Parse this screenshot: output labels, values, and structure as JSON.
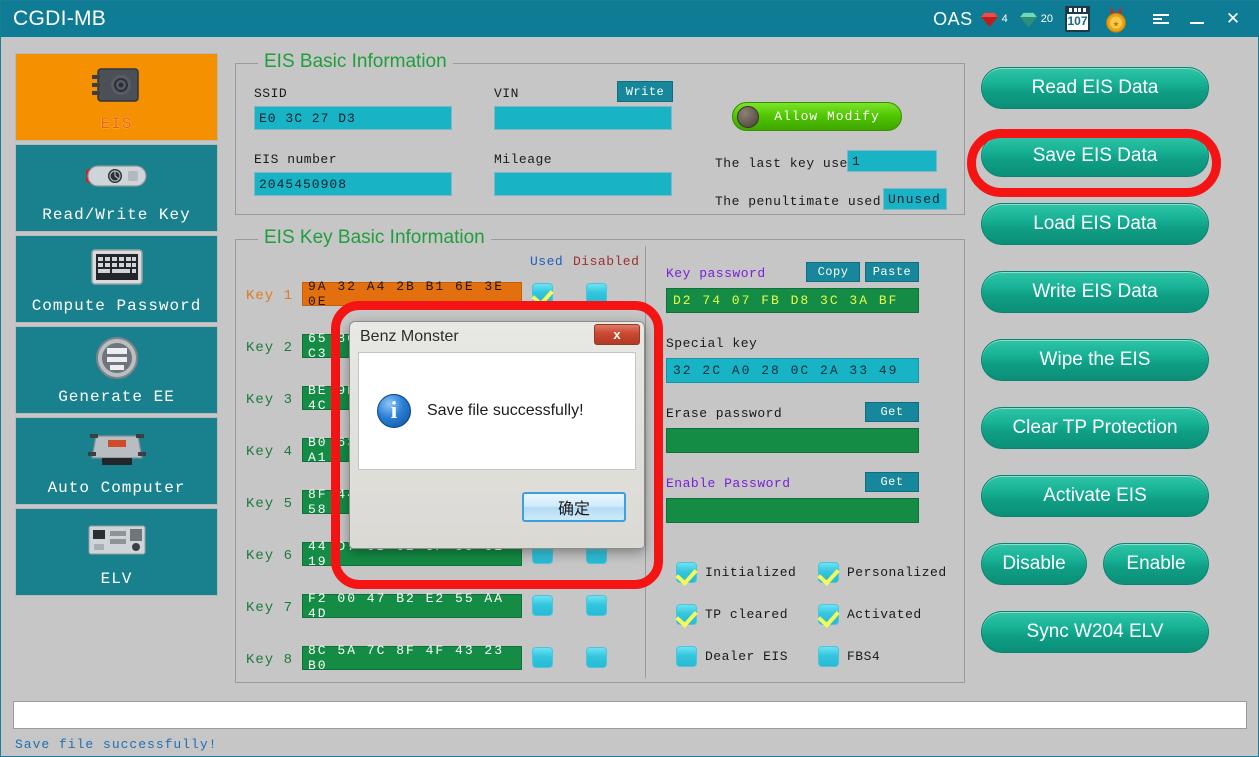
{
  "window": {
    "app_title": "CGDI-MB",
    "oas_label": "OAS",
    "red_gem_count": "4",
    "green_gem_count": "20",
    "calendar_count": "107",
    "menu_icon": "menu-icon",
    "minimize_icon": "minimize-icon",
    "close_icon": "close-icon",
    "medal_icon": "medal-icon"
  },
  "sidebar": {
    "items": [
      {
        "label": "EIS",
        "icon": "eis-module-icon",
        "active": true
      },
      {
        "label": "Read/Write Key",
        "icon": "car-key-icon",
        "active": false
      },
      {
        "label": "Compute Password",
        "icon": "keyboard-icon",
        "active": false
      },
      {
        "label": "Generate EE",
        "icon": "chip-circle-icon",
        "active": false
      },
      {
        "label": "Auto Computer",
        "icon": "ecu-icon",
        "active": false
      },
      {
        "label": "ELV",
        "icon": "circuit-board-icon",
        "active": false
      }
    ]
  },
  "basic_info": {
    "title": "EIS Basic Information",
    "ssid_label": "SSID",
    "ssid_value": "E0 3C 27 D3",
    "vin_label": "VIN",
    "vin_value": "",
    "write_button": "Write",
    "eis_number_label": "EIS number",
    "eis_number_value": "2045450908",
    "mileage_label": "Mileage",
    "mileage_value": "",
    "allow_modify_label": "Allow Modify",
    "last_key_used_label": "The last key used",
    "last_key_used_value": "1",
    "penultimate_label": "The penultimate used",
    "penultimate_value": "Unused"
  },
  "key_info": {
    "title": "EIS Key Basic Information",
    "col_used": "Used",
    "col_disabled": "Disabled",
    "keys": [
      {
        "label": "Key 1",
        "value": "9A 32 A4 2B B1 6E 3E 0E",
        "used": true,
        "disabled": false,
        "highlight": true
      },
      {
        "label": "Key 2",
        "value": "65 8C 1D 4A 70 2F 91 C3",
        "used": false,
        "disabled": false,
        "highlight": false
      },
      {
        "label": "Key 3",
        "value": "BE 9D 52 11 A8 67 30 4C",
        "used": false,
        "disabled": false,
        "highlight": false
      },
      {
        "label": "Key 4",
        "value": "B0 63 18 7D E4 29 5B A1",
        "used": false,
        "disabled": false,
        "highlight": false
      },
      {
        "label": "Key 5",
        "value": "8F 44 C2 36 90 1E 7A 58",
        "used": false,
        "disabled": false,
        "highlight": false
      },
      {
        "label": "Key 6",
        "value": "44 D7 6B 02 3F 85 CE 19",
        "used": false,
        "disabled": false,
        "highlight": false
      },
      {
        "label": "Key 7",
        "value": "F2 00 47 B2 E2 55 AA 4D",
        "used": false,
        "disabled": false,
        "highlight": false
      },
      {
        "label": "Key 8",
        "value": "8C 5A 7C 8F 4F 43 23 B0",
        "used": false,
        "disabled": false,
        "highlight": false
      }
    ],
    "key_password_label": "Key password",
    "copy_button": "Copy",
    "paste_button": "Paste",
    "key_password_value": "D2 74 07 FB D8 3C 3A BF",
    "special_key_label": "Special key",
    "special_key_value": "32 2C A0 28 0C 2A 33 49",
    "erase_password_label": "Erase password",
    "erase_get_button": "Get",
    "erase_password_value": "",
    "enable_password_label": "Enable Password",
    "enable_get_button": "Get",
    "enable_password_value": "",
    "flags": [
      {
        "label": "Initialized",
        "checked": true
      },
      {
        "label": "Personalized",
        "checked": true
      },
      {
        "label": "TP cleared",
        "checked": true
      },
      {
        "label": "Activated",
        "checked": true
      },
      {
        "label": "Dealer EIS",
        "checked": false
      },
      {
        "label": "FBS4",
        "checked": false
      }
    ]
  },
  "actions": {
    "buttons": [
      {
        "label": "Read  EIS Data"
      },
      {
        "label": "Save EIS Data"
      },
      {
        "label": "Load EIS Data"
      },
      {
        "label": "Write EIS Data"
      },
      {
        "label": "Wipe the EIS"
      },
      {
        "label": "Clear TP Protection"
      },
      {
        "label": "Activate EIS"
      },
      {
        "label": "Sync W204 ELV"
      }
    ],
    "disable_label": "Disable",
    "enable_label": "Enable"
  },
  "dialog": {
    "title": "Benz Monster",
    "message": "Save file successfully!",
    "ok_label": "确定",
    "close_label": "x",
    "info_icon": "info-icon"
  },
  "status": {
    "log_value": "",
    "message": "Save file successfully!"
  },
  "colors": {
    "titlebar": "#0e7c94",
    "sidebar_item": "#19808e",
    "sidebar_active": "#f59100",
    "group_title": "#1f9e3d",
    "textbox_teal": "#19b3c6",
    "key_green": "#148c45",
    "key_orange": "#e2700f",
    "action_button": "#11a88f",
    "annotation_red": "#f41414",
    "status_blue": "#1f6fb5"
  }
}
